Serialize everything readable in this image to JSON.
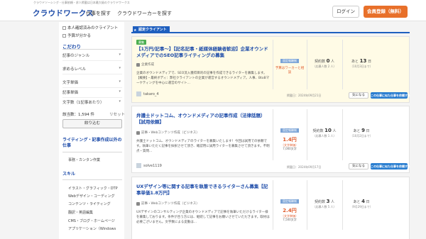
{
  "header": {
    "tagline": "クラウドソーシング・仕事依頼・求人掲載は日本最大級のクラウドワークス",
    "logo": "クラウドワークス",
    "nav": [
      "仕事を探す",
      "クラウドワーカーを探す"
    ],
    "login": "ログイン",
    "signup": "会員登録（無料）"
  },
  "sidebar": {
    "checkboxes": [
      "本人確認済みのクライアント",
      "予算が分かる"
    ],
    "narrow_heading": "こだわり",
    "filters": [
      "記事のジャンル",
      "求めるレベル",
      "文字単価",
      "記事単価",
      "文字数（1記事あたり）"
    ],
    "count_label": "該当数：1,594 件",
    "reset": "リセット",
    "narrow_button": "絞り込む",
    "other_jobs_heading": "ライティング・記事作成以外の仕事",
    "other_jobs_links": [
      "事務・カンタン作業"
    ],
    "skills_heading": "スキル",
    "skill_links": [
      "イラスト・グラフィック・DTP",
      "Webデザイン・コーディング",
      "コンテンツ・ライティング",
      "翻訳・英語編集",
      "CMS・ブログ・ホームページ",
      "アプリケーション（Windows"
    ]
  },
  "main": {
    "banner": "認定クライアント",
    "cards": [
      {
        "badge": "募集",
        "title": "【1万円/記事〜】【記名記事・紙媒体経験者歓迎】企業オウンドメディアでのSEO記事ライティングの募集",
        "category": "企業作成",
        "description": "企業のオウンドメディアで、SEO流入獲得目的の記事を作成できるライターを募集します。【概要】・最終ボディ：弊社クライアントの企業が運営するオウンドメディア。人事、BtoBマーケティングを中心に運営のサイト...",
        "client": "takaro_4",
        "posted": "掲載日：2024年09月21日",
        "price_tag": "固定報酬制",
        "price_note": "予算はワーカーと相談",
        "price_value": "",
        "price_sub": "",
        "price_example": "",
        "contracts_label": "契約数",
        "contracts": "0",
        "contracts_unit": "人",
        "applicants_sub": "（応募人数 2 人）",
        "days_label": "あと",
        "days": "13",
        "days_unit": "日",
        "deadline": "（10月3日まで）",
        "fav": "気になる",
        "apply": "この仕事に似た仕事を依頼する"
      },
      {
        "badge": "",
        "title": "弁護士ドットコム、オウンドメディアの記事作成（法律話題）【試用依頼】",
        "category": "記事・Webコンテンツ作成（ビジネス）",
        "description": "弁護士ドットコム、オウンドメディアのライターを募集いたします！今回は試用での依頼です。執筆いただく記事を採択させて頂き、確認用に試用ライターを募集させて頂きます。不明点・質問...",
        "client": "solve1119",
        "posted": "掲載日：2024年09月17日",
        "price_tag": "固定報酬制",
        "price_note": "",
        "price_value": "1.4円",
        "price_sub": "（文字単価）",
        "price_example": "7,000文字",
        "contracts_label": "契約数",
        "contracts": "10",
        "contracts_unit": "人",
        "applicants_sub": "（応募人数 1 人）",
        "days_label": "あと",
        "days": "9",
        "days_unit": "日",
        "deadline": "（10月2日まで）",
        "fav": "気になる",
        "apply": "この仕事に似た仕事を依頼する"
      },
      {
        "badge": "",
        "title": "UXデザイン等に関する記事を執筆できるライターさん募集【記事単価1.8万円】",
        "category": "記事・Webコンテンツ作成（ビジネス）",
        "description": "UXデザインのコンサルティング企業のオウンドメディアで記事を執筆いただけるライター様を募集しております。条件が合う方には、継続して記事をお願いさせていただきます。取材は必要ございません。文字数による変動は...",
        "client": "",
        "posted": "",
        "price_tag": "固定報酬制",
        "price_note": "",
        "price_value": "2.4円",
        "price_sub": "（文字単価）",
        "price_example": "7,500文字",
        "contracts_label": "契約数",
        "contracts": "3",
        "contracts_unit": "人",
        "applicants_sub": "（応募人数 5 人）",
        "days_label": "あと",
        "days": "4",
        "days_unit": "日",
        "deadline": "（9月29日まで）",
        "fav": "",
        "apply": ""
      }
    ]
  }
}
